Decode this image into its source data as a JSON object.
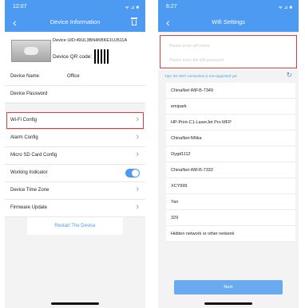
{
  "left": {
    "status": {
      "time": "12:07",
      "signal": "ᯤ ⊿ ■"
    },
    "nav": {
      "title": "Device Information"
    },
    "device": {
      "id": "Device UID:49UL3BN4KBKE1UJ511A",
      "qr_label": "Device QR code:"
    },
    "rows": [
      {
        "label": "Device Name",
        "value": "Office"
      },
      {
        "label": "Device Password"
      },
      {
        "label": "Wi-Fi Config"
      },
      {
        "label": "Alarm Config"
      },
      {
        "label": "Micro SD Card Config"
      },
      {
        "label": "Working Indicator"
      },
      {
        "label": "Device Time Zone"
      },
      {
        "label": "Firmware Update"
      }
    ],
    "restart_label": "Restart The Device",
    "toggle_on": 1
  },
  "right": {
    "status": {
      "time": "6:27",
      "signal": "ᯤ ⊿ ■"
    },
    "nav": {
      "title": "Wifi Settings"
    },
    "inputs": {
      "ssid_placeholder": "Please enter wifi name",
      "password_placeholder": "Please enter the wifi password"
    },
    "hint": "Tips: 5G WiFi connection is not supported yet",
    "networks": [
      "ChinaNet-WiFi5-7349",
      "emipark",
      "HP-Print-C1-LaserJet Pro MFP",
      "ChinaNet-NNka",
      "Oygd1112",
      "ChinaNet-WiFi5-7332",
      "XCY999",
      "Yan",
      "329",
      "Hidden network or other network"
    ],
    "next_label": "Next"
  },
  "colors": {
    "accent": "#4d9af2",
    "highlight": "#e03a3a"
  }
}
